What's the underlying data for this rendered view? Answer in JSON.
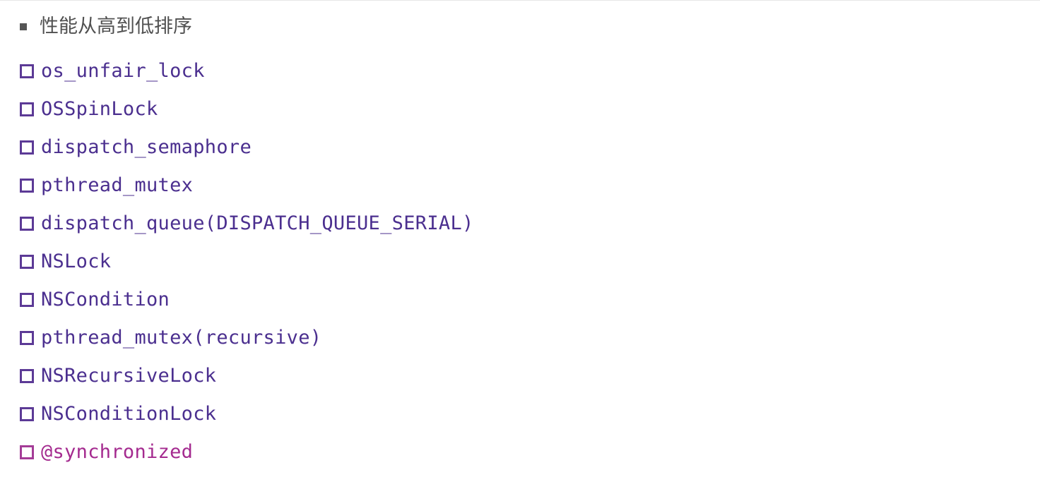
{
  "heading": {
    "text": "性能从高到低排序"
  },
  "items": [
    {
      "label": "os_unfair_lock"
    },
    {
      "label": "OSSpinLock"
    },
    {
      "label": "dispatch_semaphore"
    },
    {
      "label": "pthread_mutex"
    },
    {
      "label": "dispatch_queue(DISPATCH_QUEUE_SERIAL)"
    },
    {
      "label": "NSLock"
    },
    {
      "label": "NSCondition"
    },
    {
      "label": "pthread_mutex(recursive)"
    },
    {
      "label": "NSRecursiveLock"
    },
    {
      "label": "NSConditionLock"
    },
    {
      "label": "@synchronized"
    }
  ],
  "colors": {
    "item_text": "#4b2f8f",
    "item_checkbox": "#5c3a96",
    "last_item_text": "#a42a8f",
    "heading_text": "#505050"
  },
  "icons": {
    "heading_bullet": "square-bullet-icon",
    "item_marker": "checkbox-icon"
  }
}
